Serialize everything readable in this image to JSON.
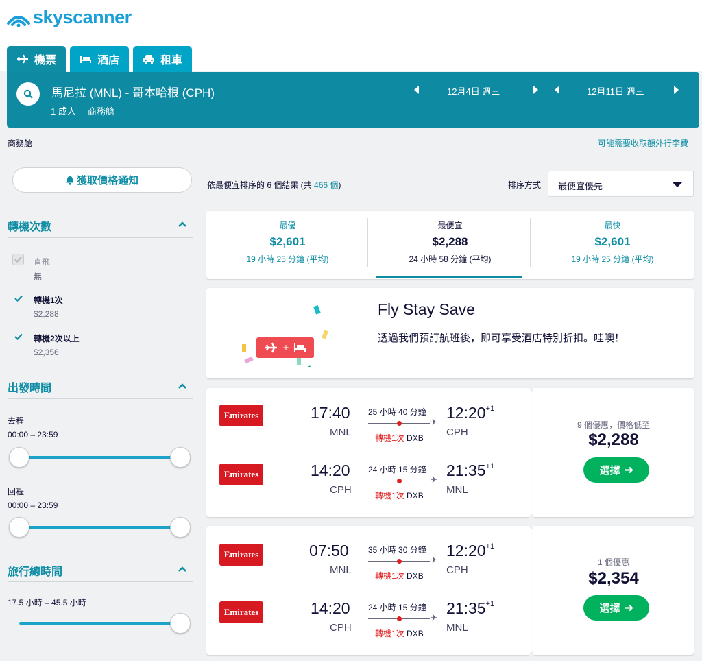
{
  "brand": {
    "name": "skyscanner",
    "color": "#1a9fd6"
  },
  "tabs": [
    {
      "label": "機票",
      "icon": "plane-icon"
    },
    {
      "label": "酒店",
      "icon": "bed-icon"
    },
    {
      "label": "租車",
      "icon": "car-icon"
    }
  ],
  "search": {
    "route": "馬尼拉 (MNL) - 哥本哈根 (CPH)",
    "passengers": "1 成人",
    "cabin": "商務艙",
    "depart_date": "12月4日 週三",
    "return_date": "12月11日 週三"
  },
  "subinfo": {
    "cabin": "商務艙",
    "baggage_link": "可能需要收取額外行李費"
  },
  "sidebar": {
    "price_alert": "獲取價格通知",
    "stops": {
      "title": "轉機次數",
      "options": [
        {
          "label": "直飛",
          "sub": "無",
          "checked": false,
          "disabled": true
        },
        {
          "label": "轉機1次",
          "sub": "$2,288",
          "checked": true
        },
        {
          "label": "轉機2次以上",
          "sub": "$2,356",
          "checked": true
        }
      ]
    },
    "times": {
      "title": "出發時間",
      "outbound_label": "去程",
      "outbound_range": "00:00 – 23:59",
      "return_label": "回程",
      "return_range": "00:00 – 23:59"
    },
    "duration": {
      "title": "旅行總時間",
      "range": "17.5 小時 – 45.5 小時"
    }
  },
  "results": {
    "count_prefix": "依最便宜排序的 6 個結果 (共 ",
    "count_total": "466 個",
    "count_suffix": ")",
    "sort_label": "排序方式",
    "sort_value": "最便宜優先"
  },
  "summary": [
    {
      "label": "最優",
      "price": "$2,601",
      "duration": "19 小時 25 分鐘 (平均)"
    },
    {
      "label": "最便宜",
      "price": "$2,288",
      "duration": "24 小時 58 分鐘 (平均)"
    },
    {
      "label": "最快",
      "price": "$2,601",
      "duration": "19 小時 25 分鐘 (平均)"
    }
  ],
  "promo": {
    "title": "Fly Stay Save",
    "text": "透過我們預訂航班後，即可享受酒店特別折扣。哇噢！"
  },
  "flights": [
    {
      "legs": [
        {
          "airline": "Emirates",
          "dep": "17:40",
          "dep_code": "MNL",
          "dur": "25 小時 40 分鐘",
          "arr": "12:20",
          "plus": "+1",
          "arr_code": "CPH",
          "stops": "轉機1次",
          "via": "DXB"
        },
        {
          "airline": "Emirates",
          "dep": "14:20",
          "dep_code": "CPH",
          "dur": "24 小時 15 分鐘",
          "arr": "21:35",
          "plus": "+1",
          "arr_code": "MNL",
          "stops": "轉機1次",
          "via": "DXB"
        }
      ],
      "deals": "9 個優惠，價格低至",
      "price": "$2,288",
      "button": "選擇"
    },
    {
      "legs": [
        {
          "airline": "Emirates",
          "dep": "07:50",
          "dep_code": "MNL",
          "dur": "35 小時 30 分鐘",
          "arr": "12:20",
          "plus": "+1",
          "arr_code": "CPH",
          "stops": "轉機1次",
          "via": "DXB"
        },
        {
          "airline": "Emirates",
          "dep": "14:20",
          "dep_code": "CPH",
          "dur": "24 小時 15 分鐘",
          "arr": "21:35",
          "plus": "+1",
          "arr_code": "MNL",
          "stops": "轉機1次",
          "via": "DXB"
        }
      ],
      "deals": "1 個優惠",
      "price": "$2,354",
      "button": "選擇"
    }
  ]
}
